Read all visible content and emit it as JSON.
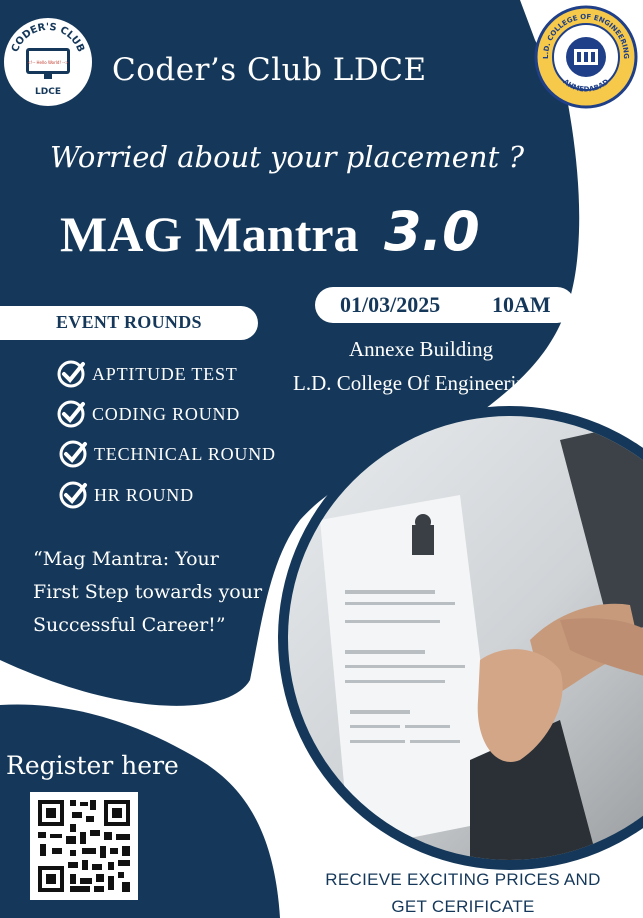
{
  "colors": {
    "navy": "#15385a",
    "white": "#ffffff"
  },
  "club_logo": {
    "top_text": "CODER'S CLUB",
    "screen_text": "<!-- Hello World! -->",
    "bottom_text": "LDCE"
  },
  "college_logo": {
    "ring_text": "L.D. COLLEGE OF ENGINEERING",
    "city": "AHMEDABAD"
  },
  "header": {
    "club_name": "Coder’s Club LDCE"
  },
  "tagline": "Worried about your placement ?",
  "event": {
    "name": "MAG Mantra",
    "version": "3.0"
  },
  "schedule": {
    "date": "01/03/2025",
    "time": "10AM"
  },
  "venue": {
    "line1": "Annexe Building",
    "line2": "L.D. College Of Engineering"
  },
  "rounds": {
    "heading": "EVENT ROUNDS",
    "items": [
      "APTITUDE TEST",
      "CODING ROUND",
      "TECHNICAL ROUND",
      "HR ROUND"
    ]
  },
  "quote": "“Mag Mantra: Your First Step towards your Successful Career!”",
  "register": {
    "label": "Register here",
    "qr_icon": "qr-code"
  },
  "photo_icon": "handshake-over-resume",
  "prizes": {
    "line1": "RECIEVE EXCITING PRICES AND",
    "line2": "GET CERIFICATE"
  }
}
